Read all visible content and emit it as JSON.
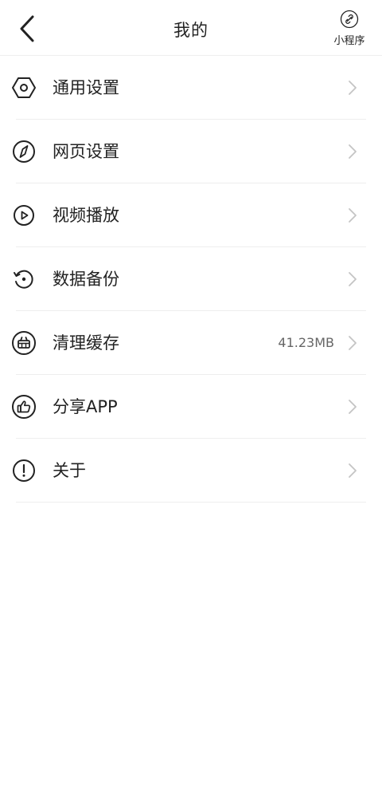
{
  "header": {
    "title": "我的",
    "back_icon": "chevron-left-icon",
    "mini_program": {
      "icon": "link-icon",
      "label": "小程序"
    }
  },
  "menu": [
    {
      "id": "general-settings",
      "label": "通用设置",
      "icon": "hexagon-settings-icon",
      "value": ""
    },
    {
      "id": "web-settings",
      "label": "网页设置",
      "icon": "compass-icon",
      "value": ""
    },
    {
      "id": "video-playback",
      "label": "视频播放",
      "icon": "play-circle-icon",
      "value": ""
    },
    {
      "id": "data-backup",
      "label": "数据备份",
      "icon": "refresh-backup-icon",
      "value": ""
    },
    {
      "id": "clear-cache",
      "label": "清理缓存",
      "icon": "basket-icon",
      "value": "41.23MB"
    },
    {
      "id": "share-app",
      "label": "分享APP",
      "icon": "thumbs-up-icon",
      "value": ""
    },
    {
      "id": "about",
      "label": "关于",
      "icon": "exclamation-circle-icon",
      "value": ""
    }
  ]
}
